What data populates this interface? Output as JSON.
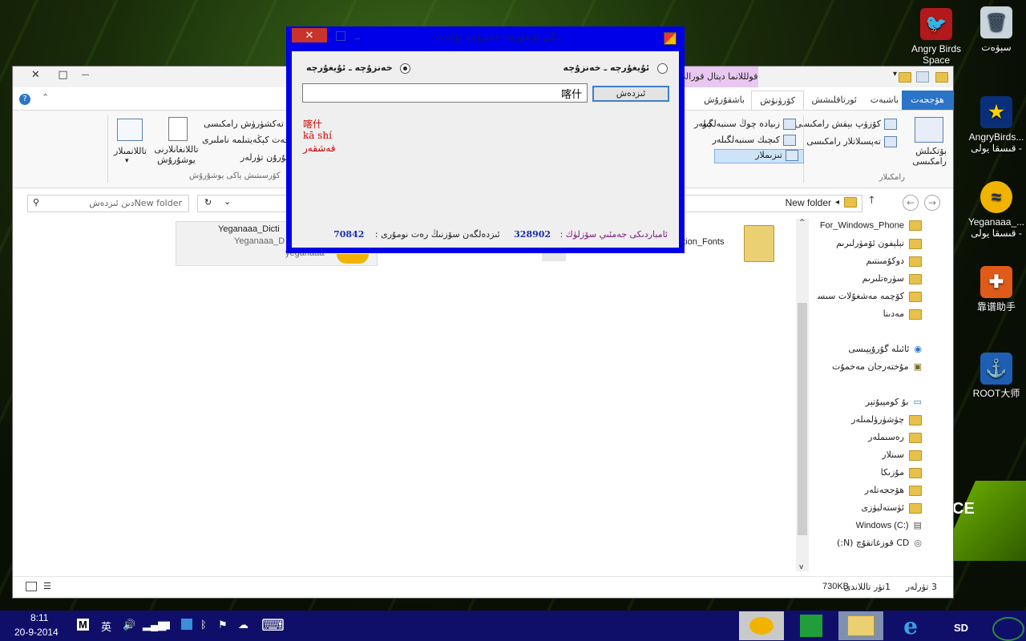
{
  "desktop": {
    "icons": [
      {
        "label": "سېۋەت",
        "glyph": "🗑",
        "bg": "#c9d4dd"
      },
      {
        "label": "Angry Birds Space",
        "glyph": "🐦",
        "bg": "#b3191b"
      },
      {
        "label": "AngryBirds... قىسقا يولى -",
        "glyph": "★",
        "bg": "#0a2f7a"
      },
      {
        "label": "Yeganaaa_... قىسقا يولى -",
        "glyph": "≈",
        "bg": "#f0b400"
      },
      {
        "label": "靠谱助手",
        "glyph": "✚",
        "bg": "#e05a1a"
      },
      {
        "label": "ROOT大师",
        "glyph": "⚓",
        "bg": "#1e5fb4"
      }
    ],
    "brand_text": "CE"
  },
  "explorer": {
    "title_buttons": {
      "close": "✕",
      "restore": "□",
      "minimize": "—"
    },
    "contextual_tab": "قولللانما دېتال قورالى",
    "tabs": [
      "ھۆججەت",
      "باشبەت",
      "ئورتاقلىشش",
      "كۆرۈنۈش",
      "باشقۇرۇش"
    ],
    "ribbon": {
      "layout_group": "رامكىلار",
      "panes": [
        "بۆتكىلش رامكىسى",
        "كۆزۈپ بېقش رامكىسى",
        "تەپسىلاتلار رامكىسى"
      ],
      "layout": [
        "زىيادە چوڭ سىنبەلگىلەر",
        "كىچىك سىنبەلگىلەر",
        "تىزىملار"
      ],
      "current_view": [
        "ئۇزا تەكشۈرۈش رامكىسى",
        "ھۆججەت كېڭەيتىلمە ناملىرى",
        "يوشۇرۇن تۈرلەر"
      ],
      "hide_selected": "تاللانغانلارنى يوشۇرۇش",
      "options": "تاللانمىلار",
      "show_hide_group": "كۆرسىتىش ياكى يوشۇرۇش"
    },
    "address": {
      "path": "New folder",
      "search_placeholder": "New folderدىن ئىزدەش"
    },
    "files": [
      {
        "name": "Yeganaaa_Dicti",
        "sub": "Yeganaaa_D",
        "sub2": "yeganaaa"
      },
      {
        "name": "ation_Fonts"
      }
    ],
    "nav": [
      "For_Windows_Phone",
      "تېلېفون ئۆمۈرلىرىم",
      "دوكۇمىنتىم",
      "سۈرەتلىرىم",
      "كۆچمە مەشغۇلات سىستېمىلىرى",
      "مەدىنا",
      "ئائىلە گۇرۇپپىسى",
      "مۇختەرجان مەخمۇت",
      "بۇ كومپيۇتېر",
      "چۈشۈرۈلمىلەر",
      "رەسىملەر",
      "سىنلار",
      "مۇزىكا",
      "ھۆججەتلەر",
      "ئۈستەلیۈزى",
      "Windows (C:)",
      "CD قوزغاتقۇچ (N:)"
    ],
    "status": {
      "count": "3 تۈرلەر",
      "selected": "1تۈر تاللاندى",
      "size": "730KB"
    }
  },
  "dict": {
    "title": "يېڭى ئۇيغۇرچە-خەنزۇچە لۇغەت",
    "close": "✕",
    "radio_ug_cn": "ئۇيغۇرچە ـ خەنزۇچە",
    "radio_cn_ug": "خەنزۇچە ـ ئۇيغۇرچە",
    "search_value": "喀什",
    "search_button": "ئىزدەش",
    "result": {
      "hanzi": "喀什",
      "pinyin": "kā shí",
      "meaning": "قەشقەر"
    },
    "stats_label_1": "ئامباردىكى جەمئىي سۆزلۈك :",
    "stats_value_1": "328902",
    "stats_label_2": "ئىزدەلگەن سۆزنىڭ رەت نومۇرى :",
    "stats_value_2": "70842"
  },
  "taskbar": {
    "time": "8:11",
    "date": "20-9-2014",
    "ime_m": "M",
    "ime_lang": "英",
    "keyboard": "⌨",
    "sd": "SD"
  },
  "colors": {
    "dialog_border": "#0000e8",
    "taskbar": "#0f0f6a",
    "ribbon_file_tab": "#2b74c8",
    "result_red": "#d40000",
    "stat_blue": "#1c2fb0",
    "stat_purple": "#7a1a7a"
  }
}
